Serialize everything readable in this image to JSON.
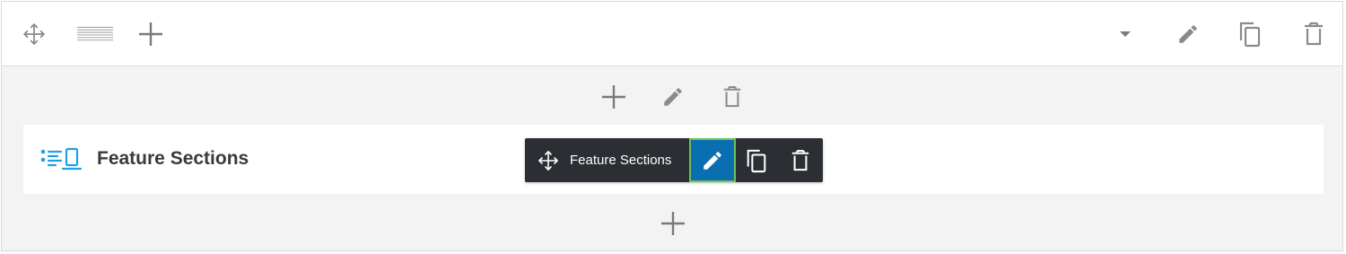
{
  "colors": {
    "frame_bg": "#f3f3f3",
    "icon_gray": "#8a8a8a",
    "toolbar_bg": "#2b2f33",
    "edit_active": "#0a6fb1",
    "edit_focus_border": "#6fc25a",
    "module_icon": "#1ea0e6"
  },
  "row_toolbar": {
    "icons": [
      "move-icon",
      "layout-icon",
      "add-icon",
      "dropdown-caret-icon",
      "edit-icon",
      "duplicate-icon",
      "delete-icon"
    ]
  },
  "column_toolbar": {
    "icons": [
      "add-icon",
      "edit-icon",
      "delete-icon"
    ]
  },
  "module": {
    "title": "Feature Sections",
    "icon": "feature-sections-icon"
  },
  "module_toolbar": {
    "label": "Feature Sections",
    "icons": [
      "move-icon",
      "edit-icon",
      "duplicate-icon",
      "delete-icon"
    ]
  },
  "bottom": {
    "icons": [
      "add-module-icon"
    ]
  }
}
